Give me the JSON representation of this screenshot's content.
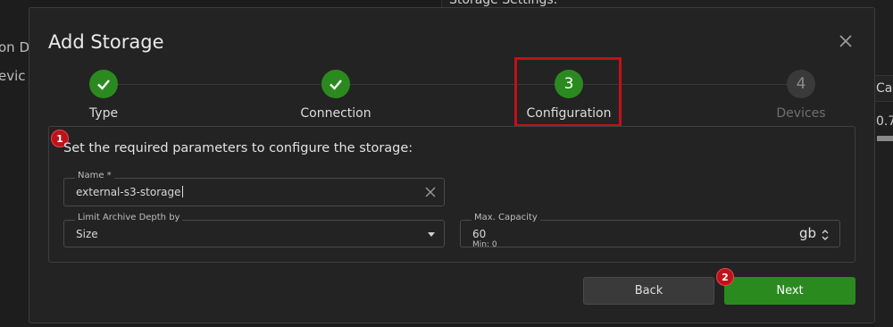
{
  "background": {
    "left_lines": [
      "on D",
      "evic"
    ],
    "top_header": "Storage Settings:",
    "right_column_header": "Cap",
    "right_value": "0.7"
  },
  "dialog": {
    "title": "Add Storage",
    "close_icon": "close-icon"
  },
  "steps": [
    {
      "number": "1",
      "label": "Type",
      "state": "done"
    },
    {
      "number": "2",
      "label": "Connection",
      "state": "done"
    },
    {
      "number": "3",
      "label": "Configuration",
      "state": "active"
    },
    {
      "number": "4",
      "label": "Devices",
      "state": "todo"
    }
  ],
  "config": {
    "instruction": "Set the required parameters to configure the storage:",
    "name_field": {
      "label": "Name *",
      "value": "external-s3-storage"
    },
    "limit_field": {
      "label": "Limit Archive Depth by",
      "value": "Size"
    },
    "capacity_field": {
      "label": "Max. Capacity",
      "value": "60",
      "unit": "gb",
      "hint": "Min: 0"
    }
  },
  "callouts": {
    "first": "1",
    "second": "2"
  },
  "buttons": {
    "back": "Back",
    "next": "Next"
  },
  "colors": {
    "accent_green": "#2b8a1f",
    "highlight_red": "#c0111b",
    "dialog_bg": "#232323"
  }
}
